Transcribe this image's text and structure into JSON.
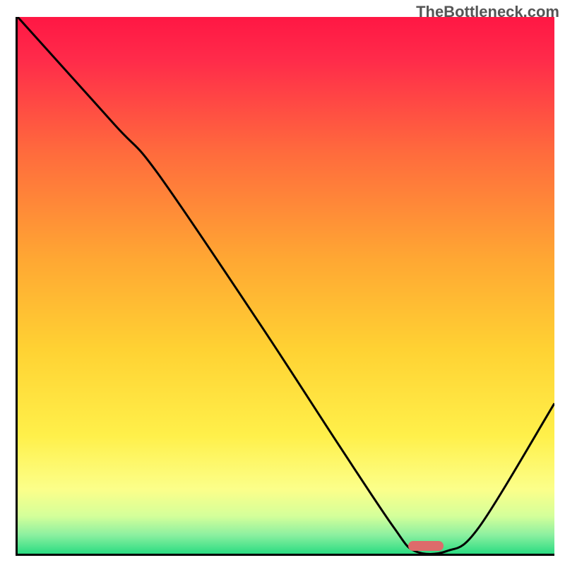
{
  "watermark": "TheBottleneck.com",
  "chart_data": {
    "type": "line",
    "title": "",
    "xlabel": "",
    "ylabel": "",
    "xlim": [
      0,
      100
    ],
    "ylim": [
      0,
      100
    ],
    "gradient_stops": [
      {
        "pos": 0.0,
        "color": "#ff1744"
      },
      {
        "pos": 0.08,
        "color": "#ff2b4a"
      },
      {
        "pos": 0.25,
        "color": "#ff6a3d"
      },
      {
        "pos": 0.45,
        "color": "#ffa733"
      },
      {
        "pos": 0.62,
        "color": "#ffd233"
      },
      {
        "pos": 0.78,
        "color": "#fff04a"
      },
      {
        "pos": 0.88,
        "color": "#fcff8a"
      },
      {
        "pos": 0.93,
        "color": "#d4ff9a"
      },
      {
        "pos": 0.965,
        "color": "#8cf0a0"
      },
      {
        "pos": 1.0,
        "color": "#2bdc82"
      }
    ],
    "curve_points": [
      {
        "x": 0,
        "y": 100
      },
      {
        "x": 18,
        "y": 80
      },
      {
        "x": 26,
        "y": 71
      },
      {
        "x": 45,
        "y": 43
      },
      {
        "x": 60,
        "y": 20
      },
      {
        "x": 70,
        "y": 5
      },
      {
        "x": 74,
        "y": 0.5
      },
      {
        "x": 80,
        "y": 0.5
      },
      {
        "x": 86,
        "y": 5
      },
      {
        "x": 100,
        "y": 28
      }
    ],
    "marker": {
      "x": 76,
      "y": 1.5,
      "width": 6
    }
  }
}
